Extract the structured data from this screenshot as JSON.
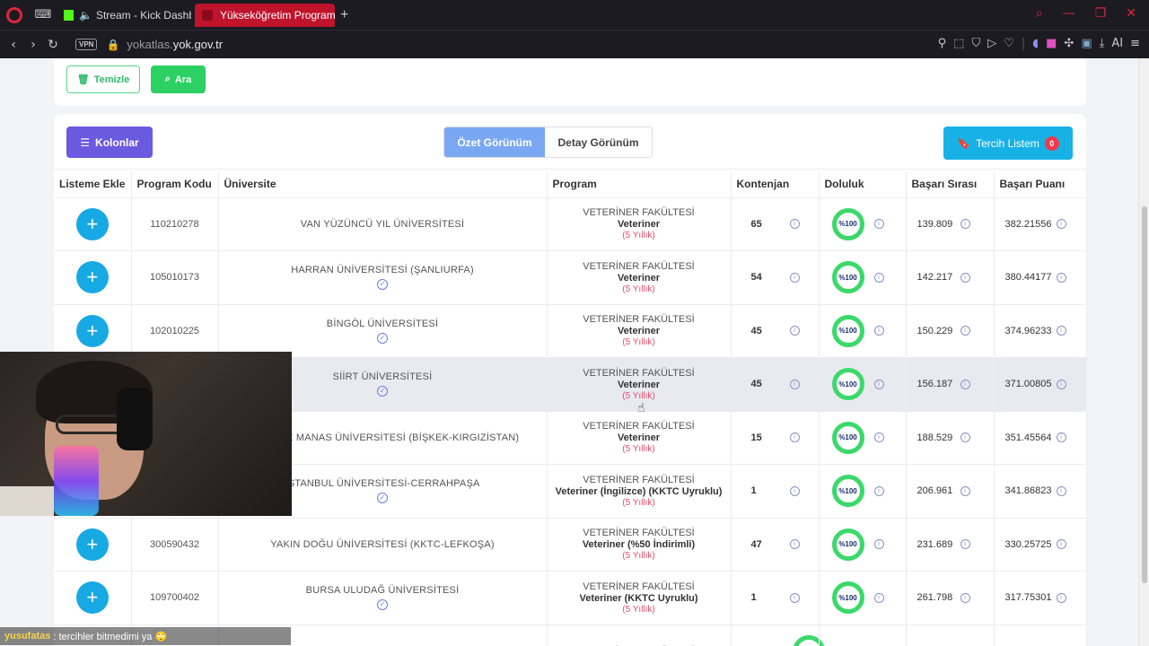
{
  "browser": {
    "tabs": [
      {
        "label": "Stream - Kick Dashboard"
      },
      {
        "label": "Yükseköğretim Program Atlası"
      }
    ],
    "vpn_label": "VPN",
    "url_prefix": "yokatlas.",
    "url_domain": "yok.gov.tr",
    "ai_label": "AI"
  },
  "filters": {
    "clear_label": "Temizle",
    "search_label": "Ara"
  },
  "toolbar": {
    "columns_label": "Kolonlar",
    "summary_view_label": "Özet Görünüm",
    "detail_view_label": "Detay Görünüm",
    "favorites_label": "Tercih Listem",
    "favorites_count": "0"
  },
  "table": {
    "headers": [
      "Listeme Ekle",
      "Program Kodu",
      "Üniversite",
      "Program",
      "Kontenjan",
      "Doluluk",
      "Başarı Sırası",
      "Başarı Puanı"
    ],
    "rows": [
      {
        "code": "110210278",
        "university": "VAN YÜZÜNCÜ YIL ÜNİVERSİTESİ",
        "verified": false,
        "faculty": "VETERİNER FAKÜLTESİ",
        "program": "Veteriner",
        "duration": "(5 Yıllık)",
        "quota": "65",
        "fill": "%100",
        "rank": "139.809",
        "score": "382.21556"
      },
      {
        "code": "105010173",
        "university": "HARRAN ÜNİVERSİTESİ (ŞANLIURFA)",
        "verified": true,
        "faculty": "VETERİNER FAKÜLTESİ",
        "program": "Veteriner",
        "duration": "(5 Yıllık)",
        "quota": "54",
        "fill": "%100",
        "rank": "142.217",
        "score": "380.44177"
      },
      {
        "code": "102010225",
        "university": "BİNGÖL ÜNİVERSİTESİ",
        "verified": true,
        "faculty": "VETERİNER FAKÜLTESİ",
        "program": "Veteriner",
        "duration": "(5 Yıllık)",
        "quota": "45",
        "fill": "%100",
        "rank": "150.229",
        "score": "374.96233"
      },
      {
        "code": "",
        "university": "SİİRT ÜNİVERSİTESİ",
        "verified": true,
        "faculty": "VETERİNER FAKÜLTESİ",
        "program": "Veteriner",
        "duration": "(5 Yıllık)",
        "quota": "45",
        "fill": "%100",
        "rank": "156.187",
        "score": "371.00805"
      },
      {
        "code": "",
        "university": "-TÜRKİYE MANAS ÜNİVERSİTESİ (BİŞKEK-KIRGIZİSTAN)",
        "verified": false,
        "faculty": "VETERİNER FAKÜLTESİ",
        "program": "Veteriner",
        "duration": "(5 Yıllık)",
        "quota": "15",
        "fill": "%100",
        "rank": "188.529",
        "score": "351.45564"
      },
      {
        "code": "",
        "university": "İSTANBUL ÜNİVERSİTESİ-CERRAHPAŞA",
        "verified": true,
        "faculty": "VETERİNER FAKÜLTESİ",
        "program": "Veteriner (İngilizce) (KKTC Uyruklu)",
        "duration": "(5 Yıllık)",
        "quota": "1",
        "fill": "%100",
        "rank": "206.961",
        "score": "341.86823"
      },
      {
        "code": "300590432",
        "university": "YAKIN DOĞU ÜNİVERSİTESİ (KKTC-LEFKOŞA)",
        "verified": false,
        "faculty": "VETERİNER FAKÜLTESİ",
        "program": "Veteriner (%50 İndirimli)",
        "duration": "(5 Yıllık)",
        "quota": "47",
        "fill": "%100",
        "rank": "231.689",
        "score": "330.25725"
      },
      {
        "code": "109700402",
        "university": "BURSA ULUDAĞ ÜNİVERSİTESİ",
        "verified": true,
        "faculty": "VETERİNER FAKÜLTESİ",
        "program": "Veteriner (KKTC Uyruklu)",
        "duration": "(5 Yıllık)",
        "quota": "1",
        "fill": "%100",
        "rank": "261.798",
        "score": "317.75301"
      },
      {
        "code": "",
        "university": "",
        "verified": false,
        "faculty": "VETERİNER FAKÜLTESİ",
        "program": "",
        "duration": "",
        "quota": "",
        "fill": "",
        "rank": "",
        "score": ""
      }
    ]
  },
  "chat": {
    "user": "yusufatas",
    "message": ": tercihler bitmedimi ya 🙄"
  },
  "colors": {
    "accent_purple": "#6a5ae0",
    "accent_blue": "#17b1e6",
    "accent_green": "#2bd162",
    "fill_green": "#3ad96a",
    "duration_red": "#e04e6c"
  }
}
